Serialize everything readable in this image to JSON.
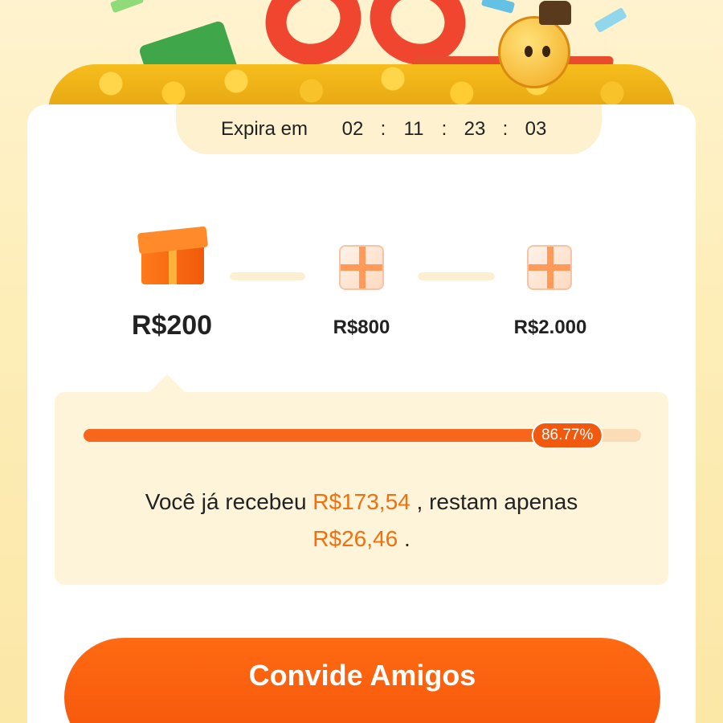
{
  "timer": {
    "label": "Expira em",
    "days": "02",
    "hours": "11",
    "minutes": "23",
    "seconds": "03",
    "separator": ":"
  },
  "tiers": [
    {
      "amount": "R$200",
      "state": "current",
      "icon": "open-gift-box-icon"
    },
    {
      "amount": "R$800",
      "state": "locked",
      "icon": "gift-box-icon"
    },
    {
      "amount": "R$2.000",
      "state": "locked",
      "icon": "gift-box-icon"
    }
  ],
  "progress": {
    "percent_label": "86.77%",
    "fraction": 0.8677,
    "message_prefix": "Você já recebeu",
    "received": "R$173,54",
    "message_middle": ", restam apenas",
    "remaining": "R$26,46",
    "message_suffix": "."
  },
  "cta": {
    "label": "Convide Amigos"
  },
  "colors": {
    "accent": "#f4540a",
    "highlight": "#f0700f",
    "panel": "#fdf4d9",
    "background": "#fdf0c4"
  }
}
